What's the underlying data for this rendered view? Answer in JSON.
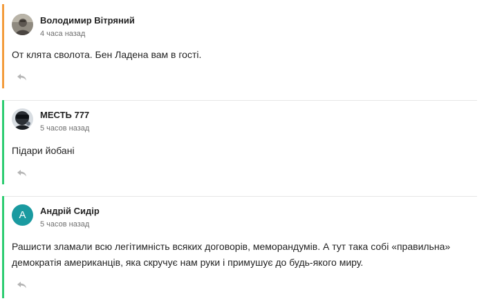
{
  "colors": {
    "comment_1_accent": "#f39c3c",
    "comment_2_accent": "#2ecc71",
    "comment_3_accent": "#2ecc71",
    "avatar_letter_bg": "#1a9aa0"
  },
  "comments": [
    {
      "author": "Володимир Вітряний",
      "time": "4 часа назад",
      "text": "От клята сволота. Бен Ладена вам в гості.",
      "avatar_type": "photo",
      "reply_icon": "reply-arrow-icon"
    },
    {
      "author": "МЕСТЬ 777",
      "time": "5 часов назад",
      "text": "Підари йобані",
      "avatar_type": "photo",
      "reply_icon": "reply-arrow-icon"
    },
    {
      "author": "Андрій Сидір",
      "time": "5 часов назад",
      "text_line_1": "Рашисти зламали всю легітимність всяких договорів, меморандумів. А тут така собі «правильна»",
      "text_line_2": "демократія американців, яка скручує нам руки і примушує до будь-якого миру.",
      "avatar_letter": "А",
      "avatar_type": "letter",
      "reply_icon": "reply-arrow-icon"
    }
  ]
}
